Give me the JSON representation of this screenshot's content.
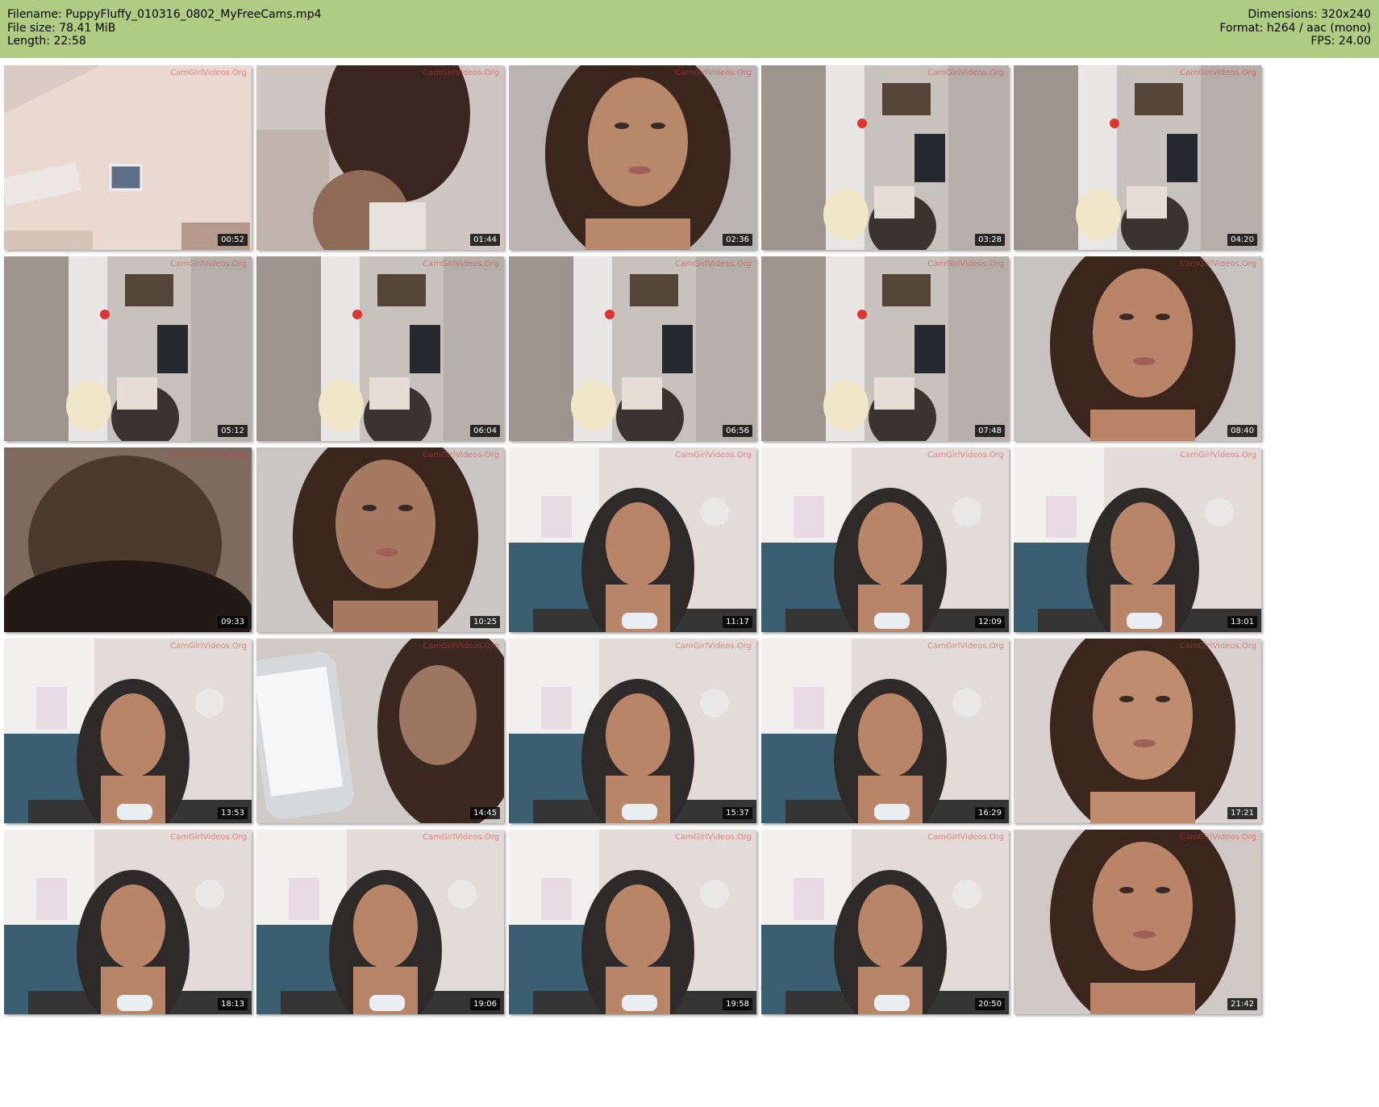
{
  "header": {
    "background_color": "#b0cc82",
    "filename_line": "Filename: PuppyFluffy_010316_0802_MyFreeCams.mp4",
    "filesize_line": "File size: 78.41 MiB",
    "length_line": "Length: 22:58",
    "dimensions_line": "Dimensions: 320x240",
    "format_line": "Format: h264 / aac (mono)",
    "fps_line": "FPS: 24.00"
  },
  "thumbnails": [
    {
      "time": "00:52",
      "watermark": "CamGirlVideos.Org",
      "scene": "room-wall",
      "colors": [
        "#e9d9d1",
        "#d7c4b9",
        "#b4998c"
      ]
    },
    {
      "time": "01:44",
      "watermark": "CamGirlVideos.Org",
      "scene": "close-shoulder",
      "colors": [
        "#cfc6c2",
        "#8f6a57",
        "#3a2620"
      ]
    },
    {
      "time": "02:36",
      "watermark": "CamGirlVideos.Org",
      "scene": "face-closeup",
      "colors": [
        "#b9b3b1",
        "#b9876a",
        "#3b261e"
      ]
    },
    {
      "time": "03:28",
      "watermark": "CamGirlVideos.Org",
      "scene": "room-wardrobe",
      "colors": [
        "#c8c2bd",
        "#9c8a7d",
        "#3b3330"
      ]
    },
    {
      "time": "04:20",
      "watermark": "CamGirlVideos.Org",
      "scene": "room-wardrobe",
      "colors": [
        "#c8c2bd",
        "#9c8a7d",
        "#3b3330"
      ]
    },
    {
      "time": "05:12",
      "watermark": "CamGirlVideos.Org",
      "scene": "room-wardrobe",
      "colors": [
        "#c8c2bd",
        "#9c8a7d",
        "#3b3330"
      ]
    },
    {
      "time": "06:04",
      "watermark": "CamGirlVideos.Org",
      "scene": "room-wardrobe",
      "colors": [
        "#c8c2bd",
        "#9c8a7d",
        "#3b3330"
      ]
    },
    {
      "time": "06:56",
      "watermark": "CamGirlVideos.Org",
      "scene": "room-wardrobe",
      "colors": [
        "#c8c2bd",
        "#9c8a7d",
        "#3b3330"
      ]
    },
    {
      "time": "07:48",
      "watermark": "CamGirlVideos.Org",
      "scene": "room-wardrobe",
      "colors": [
        "#c8c2bd",
        "#9c8a7d",
        "#3b3330"
      ]
    },
    {
      "time": "08:40",
      "watermark": "CamGirlVideos.Org",
      "scene": "face-closeup",
      "colors": [
        "#c7c3c1",
        "#b98468",
        "#3a261d"
      ]
    },
    {
      "time": "09:33",
      "watermark": "CamGirlVideos.Org",
      "scene": "blur-dark",
      "colors": [
        "#7d6b60",
        "#4a3a30",
        "#241a15"
      ]
    },
    {
      "time": "10:25",
      "watermark": "CamGirlVideos.Org",
      "scene": "face-closeup",
      "colors": [
        "#c9c6c3",
        "#a67a60",
        "#3a261c"
      ]
    },
    {
      "time": "11:17",
      "watermark": "CamGirlVideos.Org",
      "scene": "room-desk",
      "colors": [
        "#e2dbd8",
        "#b98568",
        "#2f2a2a"
      ]
    },
    {
      "time": "12:09",
      "watermark": "CamGirlVideos.Org",
      "scene": "room-desk",
      "colors": [
        "#e2dbd8",
        "#b98568",
        "#2f2a2a"
      ]
    },
    {
      "time": "13:01",
      "watermark": "CamGirlVideos.Org",
      "scene": "room-desk",
      "colors": [
        "#e2dbd8",
        "#b98568",
        "#2f2a2a"
      ]
    },
    {
      "time": "13:53",
      "watermark": "CamGirlVideos.Org",
      "scene": "room-desk",
      "colors": [
        "#e2dbd8",
        "#b98568",
        "#2f2a2a"
      ]
    },
    {
      "time": "14:45",
      "watermark": "CamGirlVideos.Org",
      "scene": "phone-closeup",
      "colors": [
        "#d7d8d9",
        "#9c7660",
        "#3b2820"
      ]
    },
    {
      "time": "15:37",
      "watermark": "CamGirlVideos.Org",
      "scene": "room-desk",
      "colors": [
        "#e2dbd8",
        "#b98568",
        "#2f2a2a"
      ]
    },
    {
      "time": "16:29",
      "watermark": "CamGirlVideos.Org",
      "scene": "room-desk",
      "colors": [
        "#e2dbd8",
        "#b98568",
        "#2f2a2a"
      ]
    },
    {
      "time": "17:21",
      "watermark": "CamGirlVideos.Org",
      "scene": "face-closeup",
      "colors": [
        "#d9d1cf",
        "#c08c70",
        "#3a261c"
      ]
    },
    {
      "time": "18:13",
      "watermark": "CamGirlVideos.Org",
      "scene": "room-desk",
      "colors": [
        "#e2dbd8",
        "#b98568",
        "#2f2a2a"
      ]
    },
    {
      "time": "19:06",
      "watermark": "CamGirlVideos.Org",
      "scene": "room-desk",
      "colors": [
        "#e2dbd8",
        "#b98568",
        "#2f2a2a"
      ]
    },
    {
      "time": "19:58",
      "watermark": "CamGirlVideos.Org",
      "scene": "room-desk",
      "colors": [
        "#e2dbd8",
        "#b98568",
        "#2f2a2a"
      ]
    },
    {
      "time": "20:50",
      "watermark": "CamGirlVideos.Org",
      "scene": "room-desk",
      "colors": [
        "#e2dbd8",
        "#b98568",
        "#2f2a2a"
      ]
    },
    {
      "time": "21:42",
      "watermark": "CamGirlVideos.Org",
      "scene": "face-closeup",
      "colors": [
        "#cfc8c5",
        "#b98468",
        "#3a261c"
      ]
    }
  ]
}
